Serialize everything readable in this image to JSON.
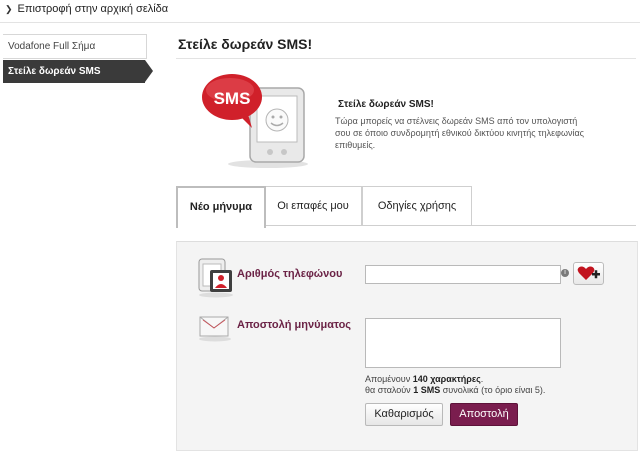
{
  "header": {
    "back_link": "Επιστροφή στην αρχική σελίδα"
  },
  "sidebar": {
    "items": [
      {
        "label": "Vodafone Full Σήμα",
        "active": false
      },
      {
        "label": "Στείλε δωρεάν SMS",
        "active": true
      }
    ]
  },
  "main": {
    "title": "Στείλε δωρεάν SMS!",
    "hero_badge": "SMS",
    "intro_title": "Στείλε δωρεάν SMS!",
    "intro_text": "Τώρα μπορείς να στέλνεις δωρεάν SMS από τον υπολογιστή σου σε όποιο συνδρομητή εθνικού δικτύου κινητής τηλεφωνίας επιθυμείς.",
    "tabs": [
      {
        "label": "Νέο μήνυμα",
        "active": true
      },
      {
        "label": "Οι επαφές μου",
        "active": false
      },
      {
        "label": "Οδηγίες χρήσης",
        "active": false
      }
    ],
    "form": {
      "phone_label": "Αριθμός τηλεφώνου",
      "phone_value": "",
      "info_icon": "i",
      "message_label": "Αποστολή μηνύματος",
      "message_value": "",
      "counter_line1_prefix": "Απομένουν",
      "counter_line1_value": "140 χαρακτήρες",
      "counter_line1_suffix": ".",
      "counter_line2_prefix": "θα σταλούν",
      "counter_line2_value": "1 SMS",
      "counter_line2_suffix": "συνολικά (το όριο είναι 5).",
      "clear_button": "Καθαρισμός",
      "send_button": "Αποστολή"
    }
  },
  "colors": {
    "accent": "#7a1d4e",
    "label": "#6b2346",
    "hero_red": "#d0202a",
    "nav_active": "#3a3a3a"
  }
}
